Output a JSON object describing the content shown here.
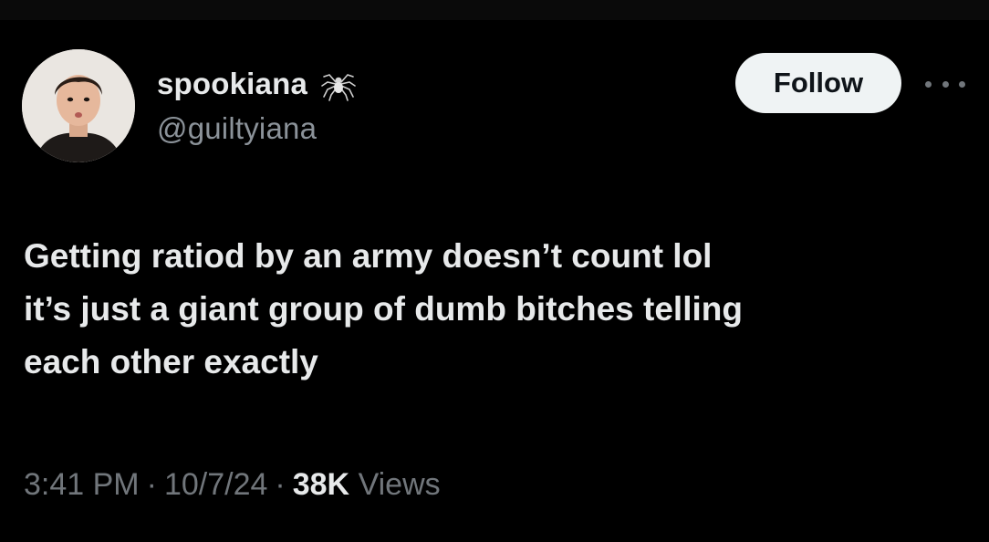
{
  "author": {
    "display_name": "spookiana",
    "handle": "@guiltyiana",
    "avatar_icon": "user-avatar",
    "badge_icon": "spider-icon"
  },
  "actions": {
    "follow_label": "Follow",
    "more_icon": "more-options-icon"
  },
  "tweet": {
    "lines": [
      "Getting ratiod by an army doesn’t count lol",
      "it’s just a giant group of dumb bitches telling",
      "each other exactly"
    ]
  },
  "meta": {
    "time": "3:41 PM",
    "separator": "·",
    "date": "10/7/24",
    "views_count": "38K",
    "views_label": "Views"
  },
  "colors": {
    "background": "#000000",
    "text_primary": "#e7e9ea",
    "text_secondary": "#71767b",
    "follow_bg": "#eff3f4",
    "follow_text": "#0f1419"
  }
}
